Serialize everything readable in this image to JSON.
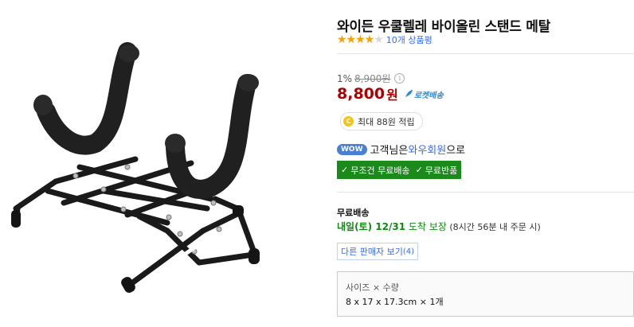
{
  "product": {
    "title": "와이든 우쿨렐레 바이올린 스탠드 메탈",
    "rating": 4,
    "rating_max": 5,
    "review_count_label": "10개 상품평"
  },
  "price": {
    "discount_rate": "1%",
    "original_price": "8,900원",
    "sale_price": "8,800",
    "currency_unit": "원",
    "rocket_label": "로켓배송"
  },
  "reward": {
    "coin_letter": "C",
    "text": "최대 88원 적립"
  },
  "wow": {
    "badge": "WOW",
    "prefix": "고객님은 ",
    "member_link": "와우회원",
    "suffix": "으로"
  },
  "free_benefits": {
    "check_icon": "✓",
    "items": [
      "무조건 무료배송",
      "무료반품"
    ]
  },
  "shipping": {
    "label": "무료배송",
    "arrival_date": "내일(토) 12/31",
    "arrival_notice": " 도착 보장",
    "arrival_condition": " (8시간 56분 내 주문 시)"
  },
  "other_sellers": {
    "label": "다른 판매자 보기",
    "count": "(4)"
  },
  "option": {
    "label": "사이즈 × 수량",
    "value": "8 x 17 x 17.3cm × 1개"
  },
  "colors": {
    "sale_price": "#ae0000",
    "link_blue": "#346aff",
    "star": "#f9a000",
    "free_green": "#1a8a1a",
    "arrival_green": "#0d8b0d"
  }
}
